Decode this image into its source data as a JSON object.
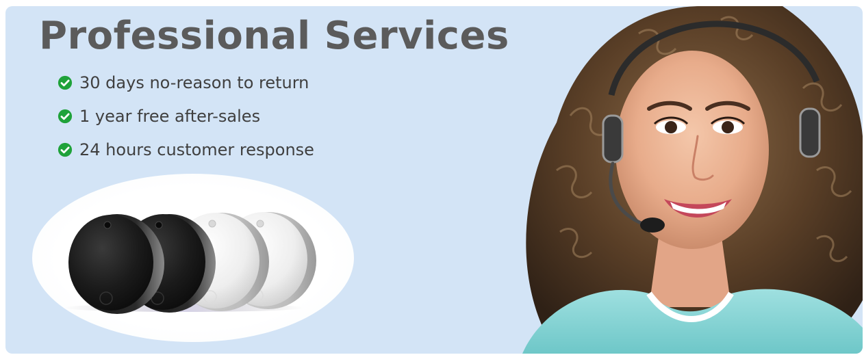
{
  "banner": {
    "title": "Professional Services",
    "background_color": "#d3e4f6",
    "title_color": "#5b5b5b",
    "check_color": "#1fa23a",
    "features": [
      {
        "text": "30 days no-reason to return",
        "icon": "check-circle-icon"
      },
      {
        "text": "1 year free after-sales",
        "icon": "check-circle-icon"
      },
      {
        "text": "24 hours customer response",
        "icon": "check-circle-icon"
      }
    ],
    "product_image": {
      "description_icon": "round-tracker-tags-image",
      "tag_colors": [
        "black",
        "black",
        "white",
        "white"
      ]
    },
    "agent_image": {
      "description_icon": "support-agent-headset-photo"
    }
  }
}
